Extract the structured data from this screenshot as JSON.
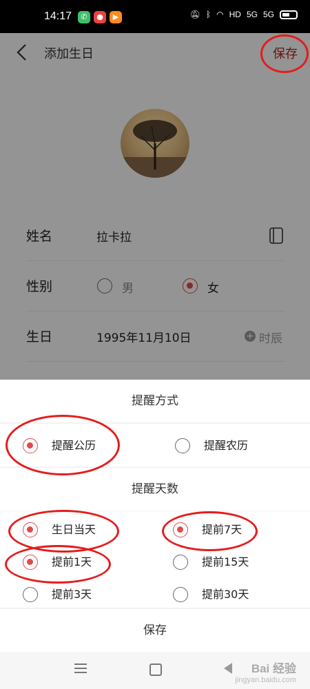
{
  "status": {
    "time": "14:17",
    "hd": "HD",
    "sig1": "5G",
    "sig2": "5G"
  },
  "header": {
    "title": "添加生日",
    "save": "保存"
  },
  "form": {
    "name": {
      "label": "姓名",
      "value": "拉卡拉"
    },
    "gender": {
      "label": "性别",
      "male": "男",
      "female": "女",
      "selected": "女"
    },
    "birthday": {
      "label": "生日",
      "value": "1995年11月10日",
      "hour": "时辰"
    }
  },
  "sheet": {
    "remind_method_title": "提醒方式",
    "remind_method": [
      {
        "label": "提醒公历",
        "checked": true
      },
      {
        "label": "提醒农历",
        "checked": false
      }
    ],
    "remind_days_title": "提醒天数",
    "remind_days": [
      {
        "label": "生日当天",
        "checked": true
      },
      {
        "label": "提前7天",
        "checked": true
      },
      {
        "label": "提前1天",
        "checked": true
      },
      {
        "label": "提前15天",
        "checked": false
      },
      {
        "label": "提前3天",
        "checked": false
      },
      {
        "label": "提前30天",
        "checked": false
      }
    ],
    "save": "保存"
  },
  "watermark": {
    "brand": "Bai 经验",
    "site": "jingyan.baidu.com"
  },
  "colors": {
    "accent": "#e14a4a",
    "annotation": "#e51c1c"
  }
}
